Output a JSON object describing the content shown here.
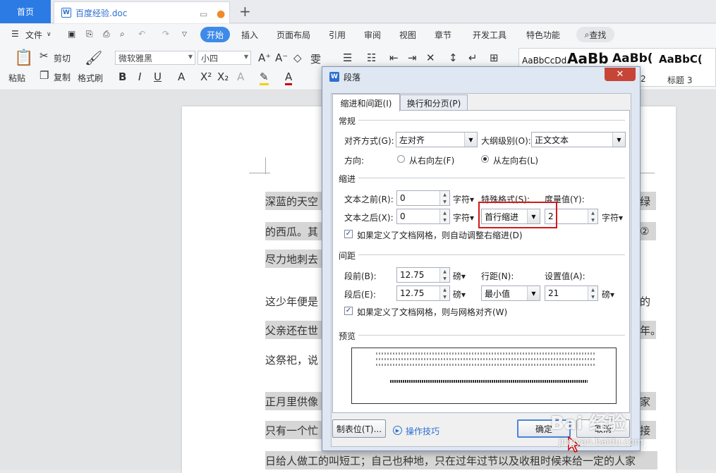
{
  "tabs": {
    "home": "首页",
    "doc": "百度经验.doc"
  },
  "menu": {
    "file": "文件",
    "items": [
      "开始",
      "插入",
      "页面布局",
      "引用",
      "审阅",
      "视图",
      "章节",
      "开发工具",
      "特色功能"
    ],
    "search": "查找"
  },
  "ribbon": {
    "paste": "粘贴",
    "cut": "剪切",
    "copy": "复制",
    "format_painter": "格式刷",
    "font": "微软雅黑",
    "size": "小四",
    "styles": [
      {
        "sample": "AaBbCcDd",
        "name": ""
      },
      {
        "sample": "AaBb",
        "name": "2"
      },
      {
        "sample": "AaBb(",
        "name": ""
      },
      {
        "sample": "AaBbC(",
        "name": "标题 3"
      }
    ]
  },
  "document": {
    "lines": [
      {
        "text": "深蓝的天空",
        "tail": "绿"
      },
      {
        "text": "的西瓜。其",
        "tail": "②"
      },
      {
        "text": "尽力地刺去",
        "tail": ""
      },
      {
        "text": "这少年便是",
        "tail": "的"
      },
      {
        "text": "父亲还在世",
        "tail": "年。"
      },
      {
        "text": "这祭祀，说",
        "tail": ""
      },
      {
        "text": "正月里供像",
        "tail": "家"
      },
      {
        "text": "只有一个忙",
        "tail": "接"
      },
      {
        "text": "日给人做工的叫短工；自己也种地，只在过年过节以及收租时候来给一定的人家",
        "tail": ""
      }
    ]
  },
  "dialog": {
    "title": "段落",
    "close": "✕",
    "tabs": [
      "缩进和间距(I)",
      "换行和分页(P)"
    ],
    "general": {
      "title": "常规",
      "align_label": "对齐方式(G):",
      "align_value": "左对齐",
      "outline_label": "大纲级别(O):",
      "outline_value": "正文文本",
      "direction_label": "方向:",
      "rtl": "从右向左(F)",
      "ltr": "从左向右(L)"
    },
    "indent": {
      "title": "缩进",
      "before_label": "文本之前(R):",
      "before_value": "0",
      "after_label": "文本之后(X):",
      "after_value": "0",
      "unit": "字符▾",
      "special_label": "特殊格式(S):",
      "special_value": "首行缩进",
      "measure_label": "度量值(Y):",
      "measure_value": "2",
      "measure_unit": "字符▾",
      "grid_check": "如果定义了文档网格，则自动调整右缩进(D)"
    },
    "spacing": {
      "title": "间距",
      "before_label": "段前(B):",
      "before_value": "12.75",
      "after_label": "段后(E):",
      "after_value": "12.75",
      "unit": "磅▾",
      "line_label": "行距(N):",
      "line_value": "最小值",
      "setting_label": "设置值(A):",
      "setting_value": "21",
      "setting_unit": "磅▾",
      "grid_check": "如果定义了文档网格，则与网格对齐(W)"
    },
    "preview": {
      "title": "预览"
    },
    "buttons": {
      "tabs": "制表位(T)...",
      "tips": "操作技巧",
      "ok": "确定",
      "cancel": "取消"
    }
  },
  "watermark": {
    "brand": "Bai 经验",
    "url": "jingyan.baidu.com"
  },
  "colors": {
    "accent": "#3e8ae8",
    "highlight": "#d11a1a"
  }
}
